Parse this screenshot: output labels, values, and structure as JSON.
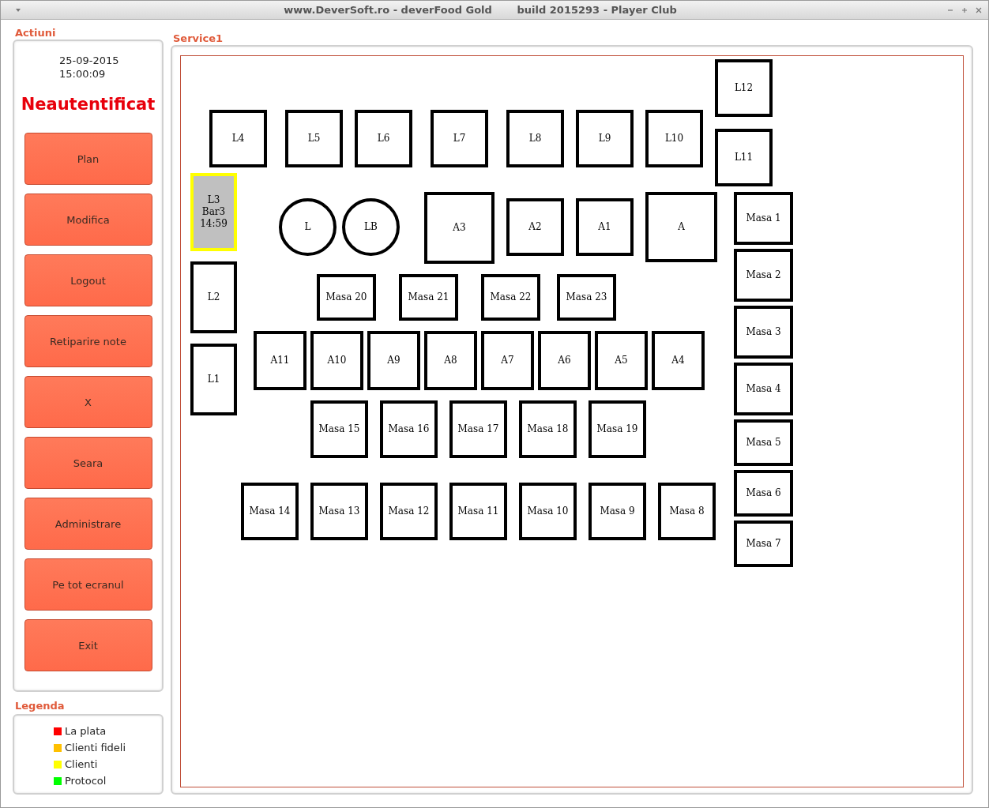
{
  "window": {
    "title": "www.DeverSoft.ro - deverFood Gold       build 2015293 - Player Club"
  },
  "actions": {
    "heading": "Actiuni",
    "date": "25-09-2015",
    "time": "15:00:09",
    "user_status": "Neautentificat",
    "buttons": [
      "Plan",
      "Modifica",
      "Logout",
      "Retiparire note",
      "X",
      "Seara",
      "Administrare",
      "Pe tot ecranul",
      "Exit"
    ]
  },
  "legend": {
    "heading": "Legenda",
    "items": [
      {
        "label": "La plata",
        "color": "#ff0000"
      },
      {
        "label": "Clienti fideli",
        "color": "#ffc000"
      },
      {
        "label": "Clienti",
        "color": "#ffff00"
      },
      {
        "label": "Protocol",
        "color": "#00ff00"
      }
    ]
  },
  "floor": {
    "title": "Service1",
    "tables": [
      {
        "kind": "square",
        "lines": [
          "L12"
        ],
        "occupied": false
      },
      {
        "kind": "square",
        "lines": [
          "L4"
        ],
        "occupied": false
      },
      {
        "kind": "square",
        "lines": [
          "L5"
        ],
        "occupied": false
      },
      {
        "kind": "square",
        "lines": [
          "L6"
        ],
        "occupied": false
      },
      {
        "kind": "square",
        "lines": [
          "L7"
        ],
        "occupied": false
      },
      {
        "kind": "square",
        "lines": [
          "L8"
        ],
        "occupied": false
      },
      {
        "kind": "square",
        "lines": [
          "L9"
        ],
        "occupied": false
      },
      {
        "kind": "square",
        "lines": [
          "L10"
        ],
        "occupied": false
      },
      {
        "kind": "square",
        "lines": [
          "L11"
        ],
        "occupied": false
      },
      {
        "kind": "square",
        "lines": [
          "L3",
          "Bar3",
          "14:59"
        ],
        "occupied": true,
        "color": "#ffff00"
      },
      {
        "kind": "round",
        "lines": [
          "L"
        ],
        "occupied": false
      },
      {
        "kind": "round",
        "lines": [
          "LB"
        ],
        "occupied": false
      },
      {
        "kind": "square",
        "lines": [
          "A3"
        ],
        "occupied": false
      },
      {
        "kind": "square",
        "lines": [
          "A2"
        ],
        "occupied": false
      },
      {
        "kind": "square",
        "lines": [
          "A1"
        ],
        "occupied": false
      },
      {
        "kind": "square",
        "lines": [
          "A"
        ],
        "occupied": false
      },
      {
        "kind": "square",
        "lines": [
          "Masa 1"
        ],
        "occupied": false
      },
      {
        "kind": "square",
        "lines": [
          "Masa 2"
        ],
        "occupied": false
      },
      {
        "kind": "square",
        "lines": [
          "Masa 3"
        ],
        "occupied": false
      },
      {
        "kind": "square",
        "lines": [
          "Masa 4"
        ],
        "occupied": false
      },
      {
        "kind": "square",
        "lines": [
          "Masa 5"
        ],
        "occupied": false
      },
      {
        "kind": "square",
        "lines": [
          "Masa 6"
        ],
        "occupied": false
      },
      {
        "kind": "square",
        "lines": [
          "Masa 7"
        ],
        "occupied": false
      },
      {
        "kind": "square",
        "lines": [
          "L2"
        ],
        "occupied": false
      },
      {
        "kind": "square",
        "lines": [
          "L1"
        ],
        "occupied": false
      },
      {
        "kind": "square",
        "lines": [
          "Masa 20"
        ],
        "occupied": false
      },
      {
        "kind": "square",
        "lines": [
          "Masa 21"
        ],
        "occupied": false
      },
      {
        "kind": "square",
        "lines": [
          "Masa 22"
        ],
        "occupied": false
      },
      {
        "kind": "square",
        "lines": [
          "Masa 23"
        ],
        "occupied": false
      },
      {
        "kind": "square",
        "lines": [
          "A11"
        ],
        "occupied": false
      },
      {
        "kind": "square",
        "lines": [
          "A10"
        ],
        "occupied": false
      },
      {
        "kind": "square",
        "lines": [
          "A9"
        ],
        "occupied": false
      },
      {
        "kind": "square",
        "lines": [
          "A8"
        ],
        "occupied": false
      },
      {
        "kind": "square",
        "lines": [
          "A7"
        ],
        "occupied": false
      },
      {
        "kind": "square",
        "lines": [
          "A6"
        ],
        "occupied": false
      },
      {
        "kind": "square",
        "lines": [
          "A5"
        ],
        "occupied": false
      },
      {
        "kind": "square",
        "lines": [
          "A4"
        ],
        "occupied": false
      },
      {
        "kind": "square",
        "lines": [
          "Masa 15"
        ],
        "occupied": false
      },
      {
        "kind": "square",
        "lines": [
          "Masa 16"
        ],
        "occupied": false
      },
      {
        "kind": "square",
        "lines": [
          "Masa 17"
        ],
        "occupied": false
      },
      {
        "kind": "square",
        "lines": [
          "Masa 18"
        ],
        "occupied": false
      },
      {
        "kind": "square",
        "lines": [
          "Masa 19"
        ],
        "occupied": false
      },
      {
        "kind": "square",
        "lines": [
          "Masa 14"
        ],
        "occupied": false
      },
      {
        "kind": "square",
        "lines": [
          "Masa 13"
        ],
        "occupied": false
      },
      {
        "kind": "square",
        "lines": [
          "Masa 12"
        ],
        "occupied": false
      },
      {
        "kind": "square",
        "lines": [
          "Masa 11"
        ],
        "occupied": false
      },
      {
        "kind": "square",
        "lines": [
          "Masa 10"
        ],
        "occupied": false
      },
      {
        "kind": "square",
        "lines": [
          "Masa 9"
        ],
        "occupied": false
      },
      {
        "kind": "square",
        "lines": [
          "Masa 8"
        ],
        "occupied": false
      }
    ]
  }
}
